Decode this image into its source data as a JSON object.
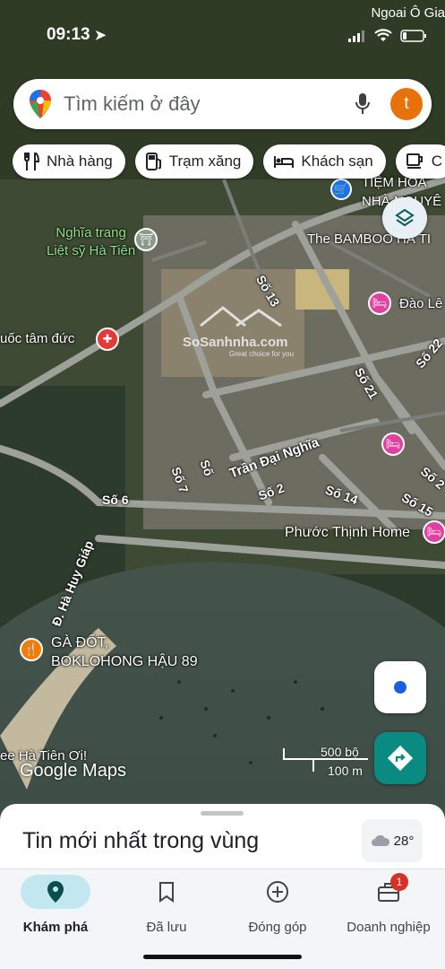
{
  "status_bar": {
    "time": "09:13",
    "carrier": "Ngoai Ô Gia"
  },
  "search": {
    "placeholder": "Tìm kiếm ở đây",
    "avatar_initial": "t",
    "accent": "#e8710a"
  },
  "chips": [
    {
      "icon": "restaurant-icon",
      "label": "Nhà hàng"
    },
    {
      "icon": "gas-station-icon",
      "label": "Trạm xăng"
    },
    {
      "icon": "hotel-icon",
      "label": "Khách sạn"
    },
    {
      "icon": "coffee-icon",
      "label": "C"
    }
  ],
  "map": {
    "places": {
      "cemetery": "Nghĩa trang\nLiệt sỹ Hà Tiên",
      "shop": "TIỆM HOA\nNHÀ NGUYÊ",
      "bamboo": "The BAMBOO HÀ TI",
      "dao": "Đào Lê",
      "pharmacy": "uốc tâm đức",
      "phuoc_thinh": "Phước Thịnh Home",
      "ga_dot": "GÀ ĐỐT,\nBOKLOHONG HẬU 89",
      "hatien_oi": "ee Hà Tiên Ơi!"
    },
    "streets": {
      "so13": "Số 13",
      "so21": "Số 21",
      "so22": "Số 22",
      "so7": "Số 7",
      "so4": "Số",
      "tran_dai_nghia": "Trần Đại Nghĩa",
      "so2": "Số 2",
      "so14": "Số 14",
      "so15": "Số 15",
      "so6": "Số 6",
      "ha_huy_giap": "Đ. Hà Huy Giáp",
      "so2b": "Số 2"
    },
    "watermark": "SoSanhnha.com",
    "watermark_sub": "Great choice for you",
    "scale_feet": "500 bộ",
    "scale_meters": "100 m",
    "logo": "Google Maps"
  },
  "sheet": {
    "title": "Tin mới nhất trong vùng",
    "temperature": "28°"
  },
  "nav": [
    {
      "icon": "explore-pin-icon",
      "label": "Khám phá"
    },
    {
      "icon": "bookmark-icon",
      "label": "Đã lưu"
    },
    {
      "icon": "add-circle-icon",
      "label": "Đóng góp"
    },
    {
      "icon": "business-icon",
      "label": "Doanh nghiệp",
      "badge": "1"
    }
  ]
}
